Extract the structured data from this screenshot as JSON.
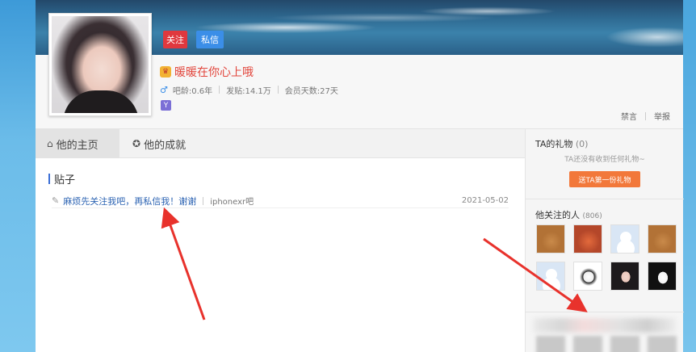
{
  "header": {
    "follow_label": "关注",
    "message_label": "私信",
    "username": "暖暖在你心上哦",
    "vip_icon": "vip-crown-icon",
    "stats": {
      "bar_age": "吧龄:0.6年",
      "posts": "发贴:14.1万",
      "member_days": "会员天数:27天"
    },
    "gender_icon": "male-icon",
    "badge_icon_text": "Y",
    "links": {
      "ban": "禁言",
      "report": "举报"
    }
  },
  "tabs": [
    {
      "label": "他的主页",
      "icon": "home-icon"
    },
    {
      "label": "他的成就",
      "icon": "achievement-icon"
    }
  ],
  "posts_section": {
    "title": "贴子",
    "items": [
      {
        "title": "麻烦先关注我吧，再私信我！谢谢",
        "forum": "iphonexr吧",
        "date": "2021-05-02"
      }
    ]
  },
  "sidebar": {
    "gifts": {
      "title": "TA的礼物",
      "count": "(0)",
      "empty_text": "TA还没有收到任何礼物~",
      "button_label": "送TA第一份礼物"
    },
    "following": {
      "title": "他关注的人",
      "count": "(806)",
      "avatars": [
        "bear",
        "lion",
        "default",
        "bear2",
        "default",
        "sketch",
        "girl",
        "anime"
      ]
    }
  },
  "colors": {
    "follow_button": "#e0383e",
    "message_button": "#3b8ee8",
    "username": "#e2463c",
    "gift_button": "#f2783a",
    "post_link": "#2d64b3",
    "annotation_arrow": "#e8322c"
  }
}
